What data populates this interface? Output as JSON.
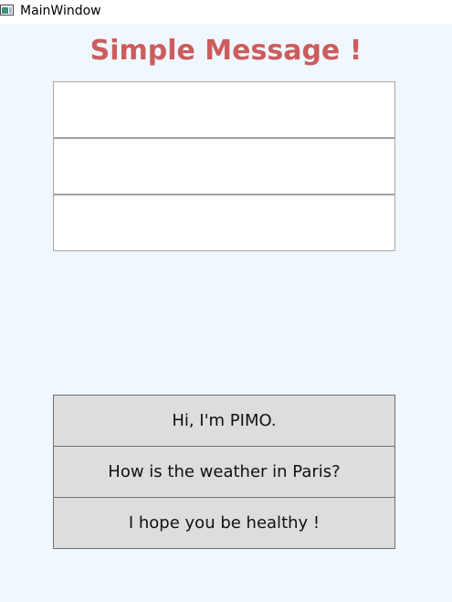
{
  "window": {
    "title": "MainWindow",
    "icon": "app-window-icon"
  },
  "header": {
    "title": "Simple Message !",
    "color": "#cd5c5c"
  },
  "message_boxes": [
    "",
    "",
    ""
  ],
  "buttons": [
    {
      "label": "Hi, I'm PIMO."
    },
    {
      "label": "How is the weather in Paris?"
    },
    {
      "label": "I hope you be healthy !"
    }
  ],
  "colors": {
    "background": "#f0f7ff",
    "button_fill": "#dddddd",
    "box_fill": "#ffffff"
  }
}
